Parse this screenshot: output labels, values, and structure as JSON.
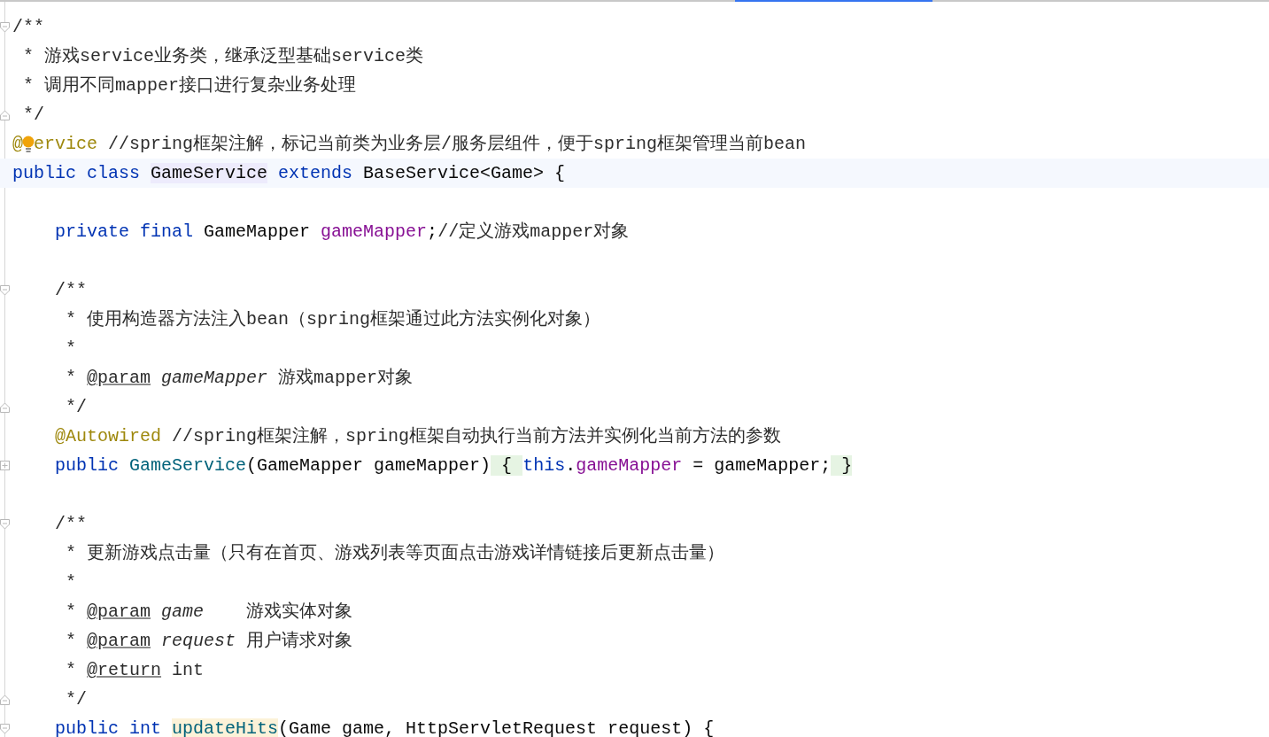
{
  "lines": [
    {
      "kind": "fold-start",
      "tokens": [
        {
          "text": "/**",
          "kind": "doc"
        }
      ]
    },
    {
      "kind": "code",
      "tokens": [
        {
          "text": " * 游戏service业务类，继承泛型基础service类",
          "kind": "doc"
        }
      ]
    },
    {
      "kind": "code",
      "tokens": [
        {
          "text": " * 调用不同mapper接口进行复杂业务处理",
          "kind": "doc"
        }
      ]
    },
    {
      "kind": "fold-end",
      "tokens": [
        {
          "text": " */",
          "kind": "doc"
        }
      ]
    },
    {
      "kind": "code",
      "tokens": [
        {
          "text": "@",
          "kind": "annotation"
        },
        {
          "kind": "bulb"
        },
        {
          "text": "ervice",
          "kind": "annotation"
        },
        {
          "text": " //spring框架注解，标记当前类为业务层/服务层组件，便于spring框架管理当前bean",
          "kind": "comment"
        }
      ]
    },
    {
      "kind": "code",
      "current": true,
      "tokens": [
        {
          "text": "public class ",
          "kind": "keyword"
        },
        {
          "text": "GameService",
          "kind": "plain",
          "color": "#edebfc"
        },
        {
          "text": " extends",
          "kind": "keyword"
        },
        {
          "text": " BaseService<Game> {",
          "kind": "plain"
        }
      ]
    },
    {
      "kind": "code"
    },
    {
      "kind": "code",
      "tokens": [
        {
          "text": "    private final ",
          "kind": "keyword"
        },
        {
          "text": "GameMapper ",
          "kind": "plain"
        },
        {
          "text": "gameMapper",
          "kind": "field"
        },
        {
          "text": ";",
          "kind": "plain"
        },
        {
          "text": "//定义游戏mapper对象",
          "kind": "comment"
        }
      ]
    },
    {
      "kind": "code"
    },
    {
      "kind": "fold-start",
      "tokens": [
        {
          "text": "    /**",
          "kind": "doc"
        }
      ]
    },
    {
      "kind": "code",
      "tokens": [
        {
          "text": "     * 使用构造器方法注入bean（spring框架通过此方法实例化对象）",
          "kind": "doc"
        }
      ]
    },
    {
      "kind": "code",
      "tokens": [
        {
          "text": "     *",
          "kind": "doc"
        }
      ]
    },
    {
      "kind": "code",
      "tokens": [
        {
          "text": "     * ",
          "kind": "doc"
        },
        {
          "text": "@param",
          "kind": "doctag"
        },
        {
          "text": " gameMapper",
          "kind": "docparam"
        },
        {
          "text": " 游戏mapper对象",
          "kind": "doc"
        }
      ]
    },
    {
      "kind": "fold-end",
      "tokens": [
        {
          "text": "     */",
          "kind": "doc"
        }
      ]
    },
    {
      "kind": "code",
      "tokens": [
        {
          "text": "    @Autowired",
          "kind": "annotation"
        },
        {
          "text": " //spring框架注解，spring框架自动执行当前方法并实例化当前方法的参数",
          "kind": "comment"
        }
      ]
    },
    {
      "kind": "folded",
      "tokens": [
        {
          "text": "    public ",
          "kind": "keyword"
        },
        {
          "text": "GameService",
          "kind": "method"
        },
        {
          "text": "(GameMapper gameMapper)",
          "kind": "plain"
        },
        {
          "text": " { ",
          "kind": "plain",
          "color": "#e6f4e3"
        },
        {
          "text": "this",
          "kind": "keyword"
        },
        {
          "text": ".",
          "kind": "plain"
        },
        {
          "text": "gameMapper",
          "kind": "field"
        },
        {
          "text": " = gameMapper;",
          "kind": "plain"
        },
        {
          "text": " }",
          "kind": "plain",
          "color": "#e6f4e3"
        }
      ]
    },
    {
      "kind": "code"
    },
    {
      "kind": "fold-start",
      "tokens": [
        {
          "text": "    /**",
          "kind": "doc"
        }
      ]
    },
    {
      "kind": "code",
      "tokens": [
        {
          "text": "     * 更新游戏点击量（只有在首页、游戏列表等页面点击游戏详情链接后更新点击量）",
          "kind": "doc"
        }
      ]
    },
    {
      "kind": "code",
      "tokens": [
        {
          "text": "     *",
          "kind": "doc"
        }
      ]
    },
    {
      "kind": "code",
      "tokens": [
        {
          "text": "     * ",
          "kind": "doc"
        },
        {
          "text": "@param",
          "kind": "doctag"
        },
        {
          "text": " game",
          "kind": "docparam"
        },
        {
          "text": "    游戏实体对象",
          "kind": "doc"
        }
      ]
    },
    {
      "kind": "code",
      "tokens": [
        {
          "text": "     * ",
          "kind": "doc"
        },
        {
          "text": "@param",
          "kind": "doctag"
        },
        {
          "text": " request",
          "kind": "docparam"
        },
        {
          "text": " 用户请求对象",
          "kind": "doc"
        }
      ]
    },
    {
      "kind": "code",
      "tokens": [
        {
          "text": "     * ",
          "kind": "doc"
        },
        {
          "text": "@return",
          "kind": "doctag"
        },
        {
          "text": " int",
          "kind": "doc"
        }
      ]
    },
    {
      "kind": "fold-end",
      "tokens": [
        {
          "text": "     */",
          "kind": "doc"
        }
      ]
    },
    {
      "kind": "fold-start",
      "tokens": [
        {
          "text": "    public int ",
          "kind": "keyword"
        },
        {
          "text": "updateHits",
          "kind": "method",
          "color": "#fcf2d8"
        },
        {
          "text": "(Game game, HttpServletRequest request) {",
          "kind": "plain"
        }
      ]
    }
  ]
}
